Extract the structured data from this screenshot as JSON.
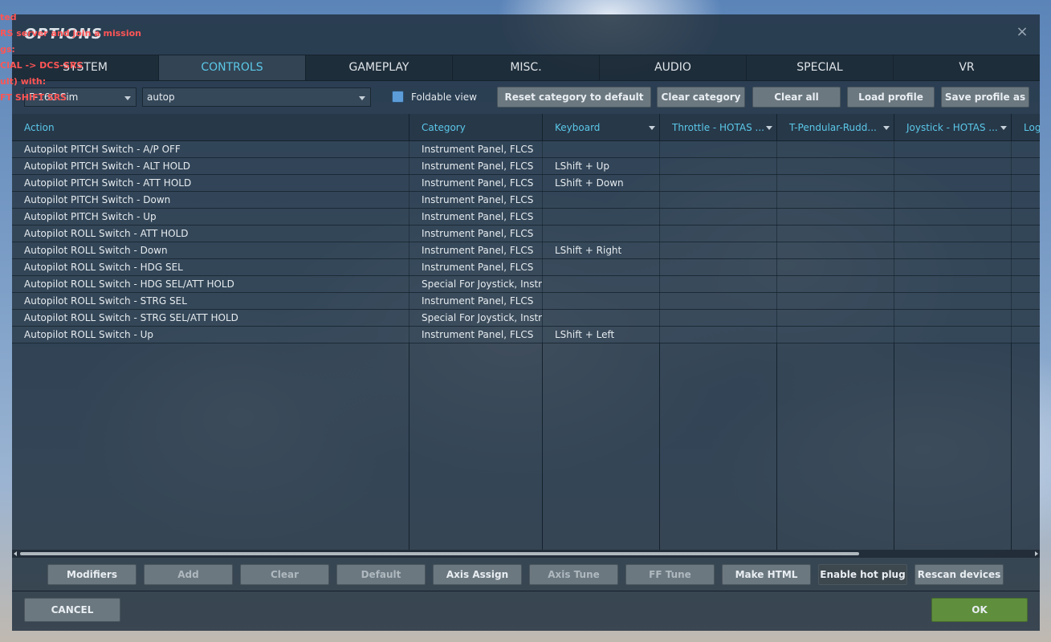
{
  "overlay": {
    "lines": [
      "ted",
      "RS server and join a mission",
      "gs:",
      "CIAL -> DCS-SRS",
      "ult) with:",
      "FT SHIFT SRS"
    ]
  },
  "dialog": {
    "title": "OPTIONS",
    "close_icon": "close-icon"
  },
  "tabs": [
    {
      "label": "SYSTEM",
      "active": false
    },
    {
      "label": "CONTROLS",
      "active": true
    },
    {
      "label": "GAMEPLAY",
      "active": false
    },
    {
      "label": "MISC.",
      "active": false
    },
    {
      "label": "AUDIO",
      "active": false
    },
    {
      "label": "SPECIAL",
      "active": false
    },
    {
      "label": "VR",
      "active": false
    }
  ],
  "toolbar": {
    "aircraft_select": "F-16C Sim",
    "filter_select": "autop",
    "foldable_label": "Foldable view",
    "foldable_checked": true,
    "buttons": {
      "reset_category": "Reset category to default",
      "clear_category": "Clear category",
      "clear_all": "Clear all",
      "load_profile": "Load profile",
      "save_profile": "Save profile as"
    }
  },
  "grid": {
    "headers": {
      "action": "Action",
      "category": "Category",
      "keyboard": "Keyboard",
      "throttle": "Throttle - HOTAS ...",
      "pendular": "T-Pendular-Rudd...",
      "joystick": "Joystick - HOTAS ...",
      "log": "Log"
    },
    "rows": [
      {
        "action": "Autopilot PITCH Switch - A/P OFF",
        "category": "Instrument Panel, FLCS",
        "keyboard": ""
      },
      {
        "action": "Autopilot PITCH Switch - ALT HOLD",
        "category": "Instrument Panel, FLCS",
        "keyboard": "LShift + Up"
      },
      {
        "action": "Autopilot PITCH Switch - ATT HOLD",
        "category": "Instrument Panel, FLCS",
        "keyboard": "LShift + Down"
      },
      {
        "action": "Autopilot PITCH Switch - Down",
        "category": "Instrument Panel, FLCS",
        "keyboard": ""
      },
      {
        "action": "Autopilot PITCH Switch - Up",
        "category": "Instrument Panel, FLCS",
        "keyboard": ""
      },
      {
        "action": "Autopilot ROLL Switch - ATT HOLD",
        "category": "Instrument Panel, FLCS",
        "keyboard": ""
      },
      {
        "action": "Autopilot ROLL Switch - Down",
        "category": "Instrument Panel, FLCS",
        "keyboard": "LShift + Right"
      },
      {
        "action": "Autopilot ROLL Switch - HDG SEL",
        "category": "Instrument Panel, FLCS",
        "keyboard": ""
      },
      {
        "action": "Autopilot ROLL Switch - HDG SEL/ATT HOLD",
        "category": "Special For Joystick, Instru",
        "keyboard": ""
      },
      {
        "action": "Autopilot ROLL Switch - STRG SEL",
        "category": "Instrument Panel, FLCS",
        "keyboard": ""
      },
      {
        "action": "Autopilot ROLL Switch - STRG SEL/ATT HOLD",
        "category": "Special For Joystick, Instru",
        "keyboard": ""
      },
      {
        "action": "Autopilot ROLL Switch - Up",
        "category": "Instrument Panel, FLCS",
        "keyboard": "LShift + Left"
      }
    ]
  },
  "bottom_buttons": {
    "modifiers": "Modifiers",
    "add": "Add",
    "clear": "Clear",
    "default": "Default",
    "axis_assign": "Axis Assign",
    "axis_tune": "Axis Tune",
    "ff_tune": "FF Tune",
    "make_html": "Make HTML",
    "enable_hot_plug": "Enable hot plug",
    "rescan_devices": "Rescan devices"
  },
  "footer": {
    "cancel": "CANCEL",
    "ok": "OK"
  },
  "colors": {
    "accent": "#5bc8e8",
    "overlay_text": "#ff5555",
    "ok_button": "#5f8f3d"
  }
}
